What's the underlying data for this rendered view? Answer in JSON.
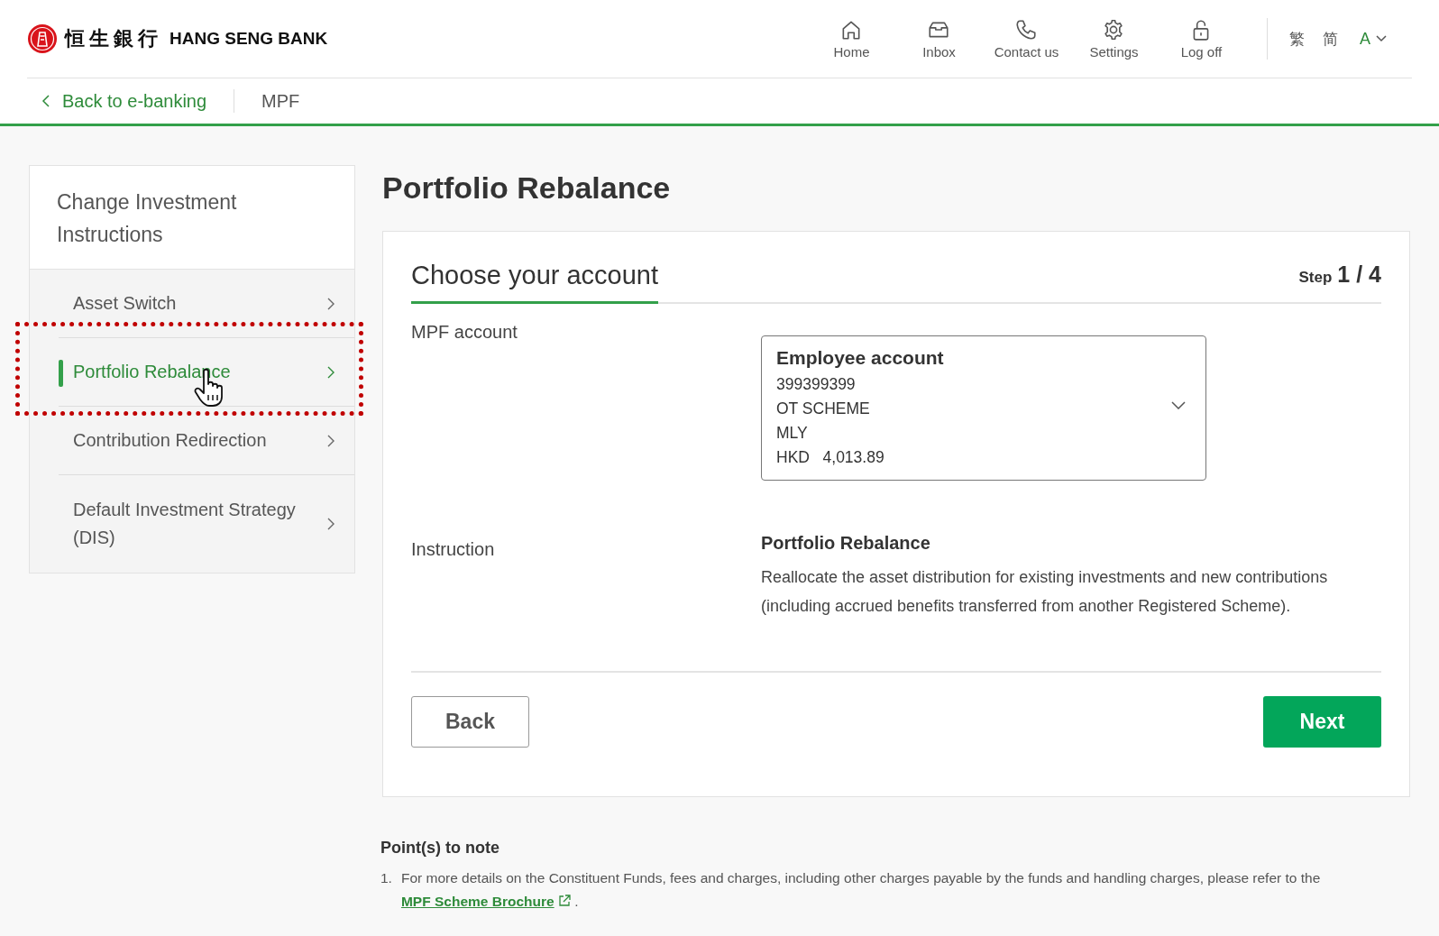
{
  "header": {
    "logo_chinese": "恒生銀行",
    "logo_english": "HANG SENG BANK",
    "nav": [
      {
        "kind": "home",
        "label": "Home"
      },
      {
        "kind": "inbox",
        "label": "Inbox"
      },
      {
        "kind": "phone",
        "label": "Contact us"
      },
      {
        "kind": "gear",
        "label": "Settings"
      },
      {
        "kind": "lock",
        "label": "Log off"
      }
    ],
    "languages": [
      {
        "label": "繁"
      },
      {
        "label": "简"
      }
    ],
    "text_size": "A"
  },
  "breadcrumb": {
    "back": "Back to e-banking",
    "current": "MPF"
  },
  "sidebar": {
    "title": "Change Investment Instructions",
    "items": [
      {
        "label": "Asset Switch",
        "selected": false
      },
      {
        "label": "Portfolio Rebalance",
        "selected": true
      },
      {
        "label": "Contribution Redirection",
        "selected": false
      },
      {
        "label": "Default Investment Strategy (DIS)",
        "selected": false
      }
    ]
  },
  "page_title": "Portfolio Rebalance",
  "card": {
    "heading": "Choose your account",
    "step_label": "Step",
    "step_value": "1 / 4",
    "account_label": "MPF account",
    "account": {
      "name": "Employee account",
      "lines": [
        "399399399",
        "OT SCHEME",
        "MLY",
        "HKD   4,013.89"
      ]
    },
    "instruction_label": "Instruction",
    "instruction_title": "Portfolio Rebalance",
    "instruction_text": "Reallocate the asset distribution for existing investments and new contributions (including accrued benefits transferred from another Registered Scheme).",
    "buttons": [
      {
        "kind": "secondary",
        "label": "Back"
      },
      {
        "kind": "primary",
        "label": "Next"
      }
    ]
  },
  "notes": {
    "heading": "Point(s) to note",
    "items": [
      {
        "number": "1.",
        "text": "For more details on the Constituent Funds, fees and charges, including other charges payable by the funds and handling charges, please refer to the",
        "link": "MPF Scheme Brochure",
        "trailing": "."
      }
    ]
  }
}
